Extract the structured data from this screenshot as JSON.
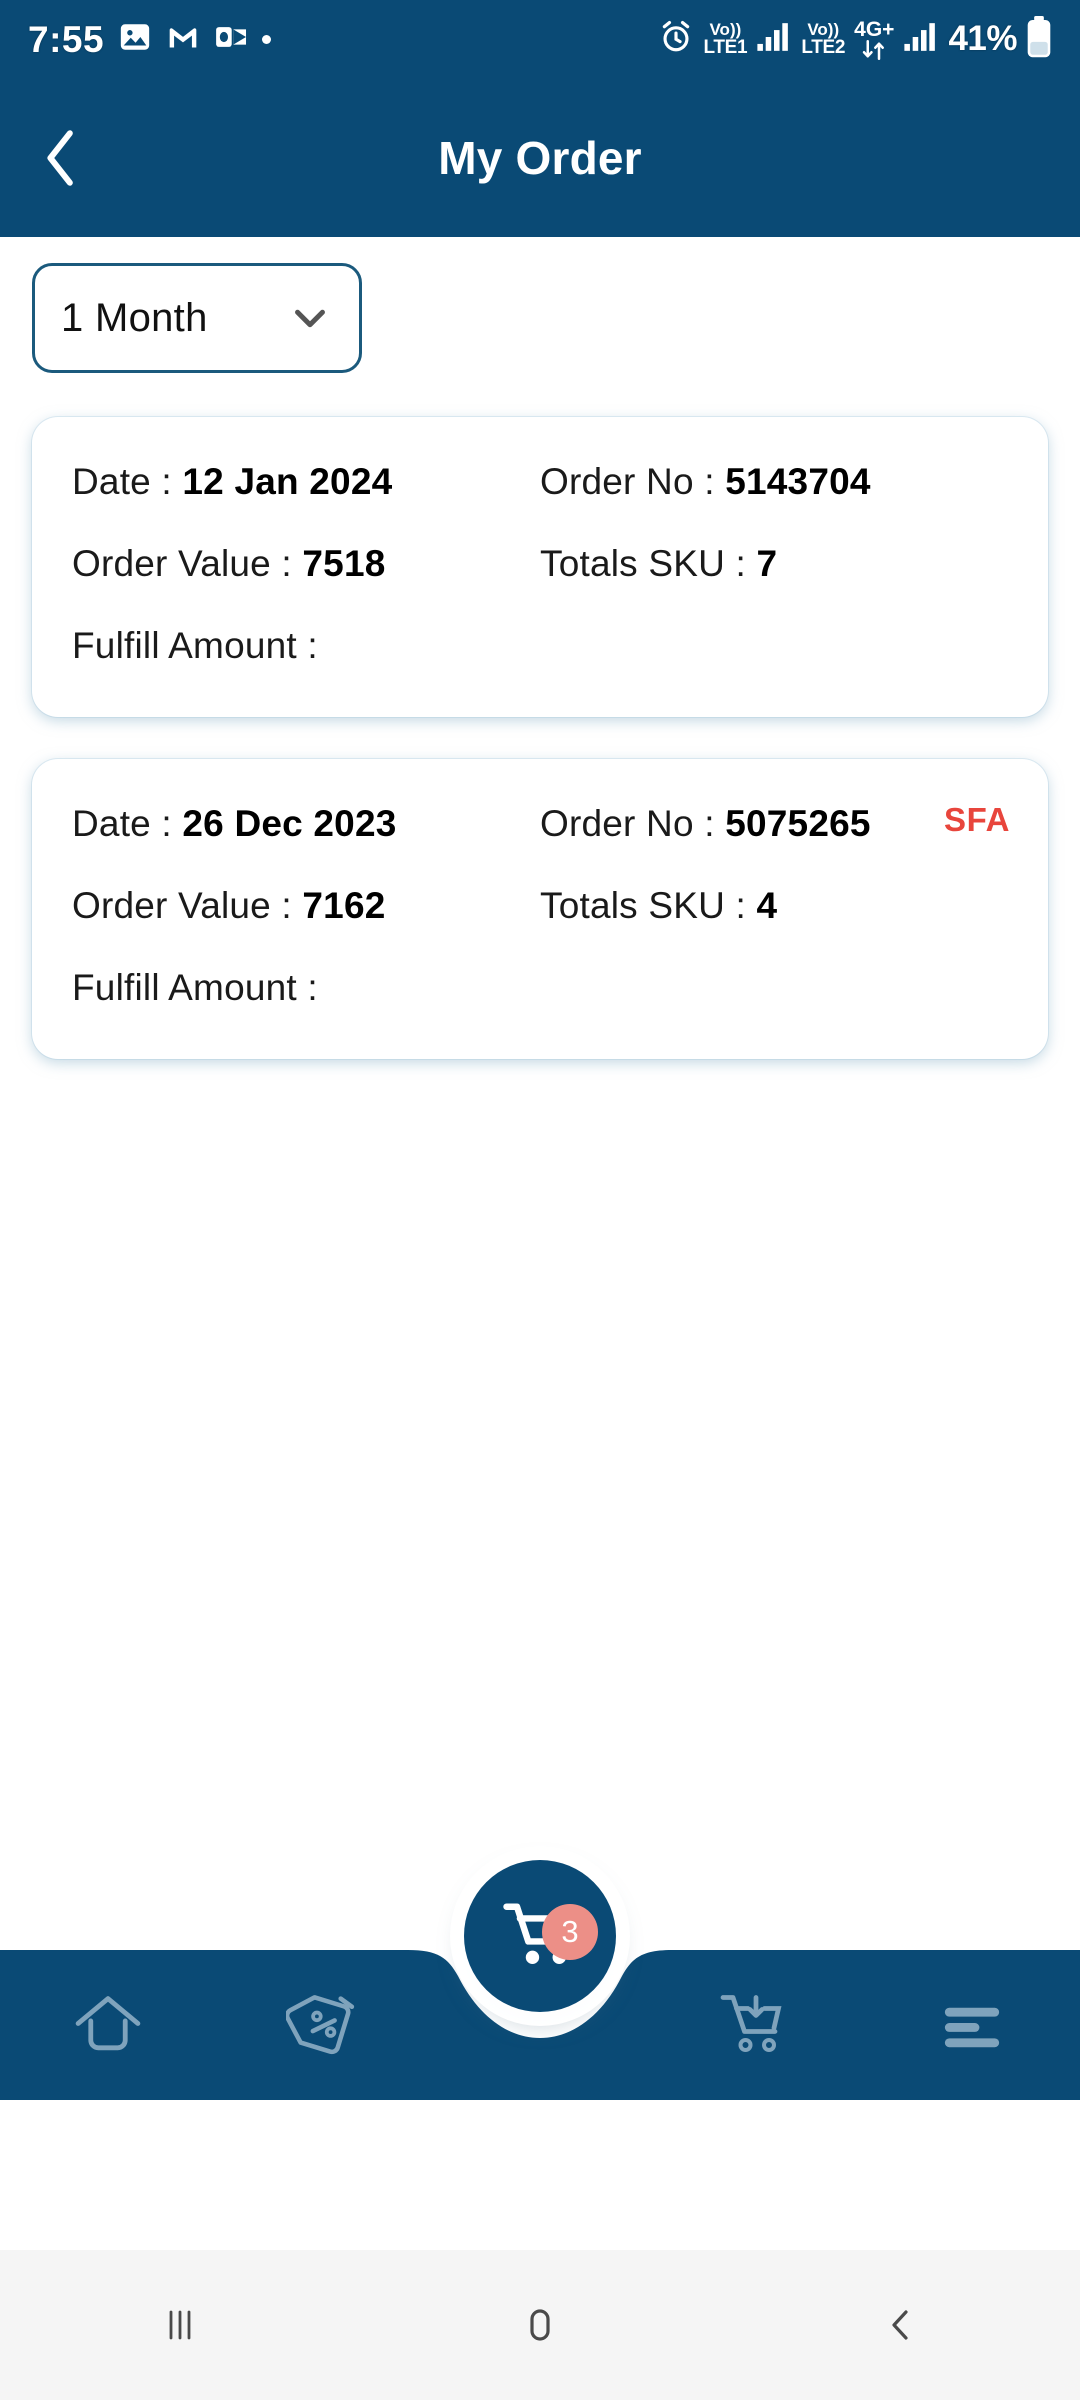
{
  "status_bar": {
    "time": "7:55",
    "icons_left": [
      "photos-icon",
      "gmail-icon",
      "outlook-icon",
      "dot-indicator-icon"
    ],
    "alarm_icon": "alarm-icon",
    "sim1_label_top": "Vo))",
    "sim1_label_bottom": "LTE1",
    "sim2_label_top": "Vo))",
    "sim2_label_bottom": "LTE2",
    "network_label": "4G+",
    "battery_percent": "41%"
  },
  "header": {
    "title": "My Order",
    "back_icon": "back-chevron-icon",
    "background_color": "#0A4A75"
  },
  "filter": {
    "selected": "1 Month",
    "caret_icon": "chevron-down-icon",
    "border_color": "#1B5A7D"
  },
  "orders": [
    {
      "date_label": "Date : ",
      "date_value": "12 Jan 2024",
      "order_no_label": "Order No : ",
      "order_no_value": "5143704",
      "order_value_label": "Order Value : ",
      "order_value_value": "7518",
      "sku_label": "Totals SKU : ",
      "sku_value": "7",
      "fulfill_label": "Fulfill Amount :",
      "fulfill_value": "",
      "badge": ""
    },
    {
      "date_label": "Date : ",
      "date_value": "26 Dec 2023",
      "order_no_label": "Order No : ",
      "order_no_value": "5075265",
      "order_value_label": "Order Value : ",
      "order_value_value": "7162",
      "sku_label": "Totals SKU : ",
      "sku_value": "4",
      "fulfill_label": "Fulfill Amount :",
      "fulfill_value": "",
      "badge": "SFA"
    }
  ],
  "badge_color": "#E8453C",
  "bottom_nav": {
    "background_color": "#0A4A75",
    "icon_color": "#7FA3BC",
    "items": [
      {
        "name": "home-icon"
      },
      {
        "name": "discount-tag-icon"
      },
      {
        "name": "cart-download-icon"
      },
      {
        "name": "hamburger-menu-icon"
      }
    ],
    "fab": {
      "icon": "shopping-cart-icon",
      "badge_count": "3",
      "badge_color": "#EC8F87",
      "background_color": "#0A4A75"
    }
  },
  "android_nav": {
    "recents_icon": "recents-icon",
    "home_icon": "home-pill-icon",
    "back_icon": "back-chevron-icon",
    "background_color": "#F5F5F5"
  }
}
